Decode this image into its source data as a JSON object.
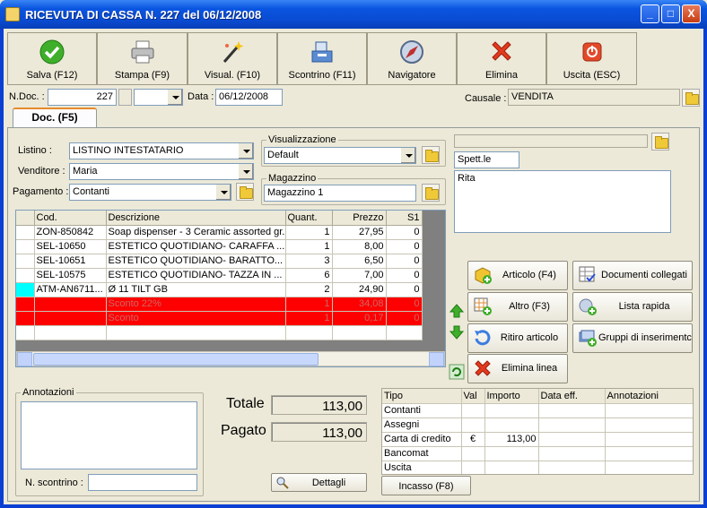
{
  "window": {
    "title": "RICEVUTA DI CASSA N.  227  del 06/12/2008",
    "min": "_",
    "max": "□",
    "close": "X"
  },
  "toolbar": [
    {
      "label": "Salva (F12)",
      "icon": "check-icon"
    },
    {
      "label": "Stampa (F9)",
      "icon": "printer-icon"
    },
    {
      "label": "Visual. (F10)",
      "icon": "magic-wand-icon"
    },
    {
      "label": "Scontrino (F11)",
      "icon": "cash-register-icon"
    },
    {
      "label": "Navigatore",
      "icon": "compass-icon"
    },
    {
      "label": "Elimina",
      "icon": "delete-x-icon"
    },
    {
      "label": "Uscita (ESC)",
      "icon": "exit-icon"
    }
  ],
  "header": {
    "ndoc_label": "N.Doc. :",
    "ndoc_value": "227",
    "data_label": "Data :",
    "data_value": "06/12/2008",
    "causale_label": "Causale :",
    "causale_value": "VENDITA"
  },
  "tab": {
    "label": "Doc. (F5)"
  },
  "form": {
    "listino_label": "Listino :",
    "listino_value": "LISTINO INTESTATARIO",
    "venditore_label": "Venditore :",
    "venditore_value": "Maria",
    "pagamento_label": "Pagamento :",
    "pagamento_value": "Contanti",
    "visualizzazione_label": "Visualizzazione",
    "visualizzazione_value": "Default",
    "magazzino_label": "Magazzino",
    "magazzino_value": "Magazzino 1"
  },
  "customer": {
    "top_value": "",
    "title_value": "Spett.le",
    "name_value": "Rita"
  },
  "grid": {
    "columns": [
      "Cod.",
      "Descrizione",
      "Quant.",
      "Prezzo",
      "S1"
    ],
    "rows": [
      {
        "cod": "ZON-850842",
        "desc": "Soap dispenser - 3 Ceramic assorted gr...",
        "qty": "1",
        "price": "27,95",
        "s1": "0",
        "style": "normal"
      },
      {
        "cod": "SEL-10650",
        "desc": "ESTETICO QUOTIDIANO- CARAFFA ...",
        "qty": "1",
        "price": "8,00",
        "s1": "0",
        "style": "normal"
      },
      {
        "cod": "SEL-10651",
        "desc": "ESTETICO QUOTIDIANO- BARATTO...",
        "qty": "3",
        "price": "6,50",
        "s1": "0",
        "style": "normal"
      },
      {
        "cod": "SEL-10575",
        "desc": "ESTETICO QUOTIDIANO- TAZZA IN ...",
        "qty": "6",
        "price": "7,00",
        "s1": "0",
        "style": "normal"
      },
      {
        "cod": "ATM-AN6711...",
        "desc": "Ø 11 TILT GB",
        "qty": "2",
        "price": "24,90",
        "s1": "0",
        "style": "normal",
        "selected": true
      },
      {
        "cod": "",
        "desc": "Sconto 22%",
        "qty": "1",
        "price": "34,08",
        "s1": "0",
        "style": "red"
      },
      {
        "cod": "",
        "desc": "Sconto",
        "qty": "1",
        "price": "0,17",
        "s1": "0",
        "style": "red"
      },
      {
        "cod": "",
        "desc": "",
        "qty": "",
        "price": "",
        "s1": "",
        "style": "normal"
      }
    ]
  },
  "actions": {
    "articolo": "Articolo (F4)",
    "documenti": "Documenti collegati",
    "altro": "Altro (F3)",
    "lista": "Lista rapida",
    "ritiro": "Ritiro articolo",
    "gruppi": "Gruppi di inserimentc",
    "elimina_linea": "Elimina linea"
  },
  "annotazioni": {
    "label": "Annotazioni",
    "value": ""
  },
  "scontrino": {
    "label": "N. scontrino :",
    "value": ""
  },
  "totals": {
    "totale_label": "Totale",
    "totale_value": "113,00",
    "pagato_label": "Pagato",
    "pagato_value": "113,00"
  },
  "dettagli": "Dettagli",
  "incasso": "Incasso (F8)",
  "payments": {
    "columns": [
      "Tipo",
      "Val",
      "Importo",
      "Data eff.",
      "Annotazioni"
    ],
    "rows": [
      {
        "tipo": "Contanti",
        "val": "",
        "importo": "",
        "data": "",
        "note": ""
      },
      {
        "tipo": "Assegni",
        "val": "",
        "importo": "",
        "data": "",
        "note": ""
      },
      {
        "tipo": "Carta di credito",
        "val": "€",
        "importo": "113,00",
        "data": "",
        "note": ""
      },
      {
        "tipo": "Bancomat",
        "val": "",
        "importo": "",
        "data": "",
        "note": ""
      },
      {
        "tipo": "Uscita",
        "val": "",
        "importo": "",
        "data": "",
        "note": ""
      }
    ]
  }
}
